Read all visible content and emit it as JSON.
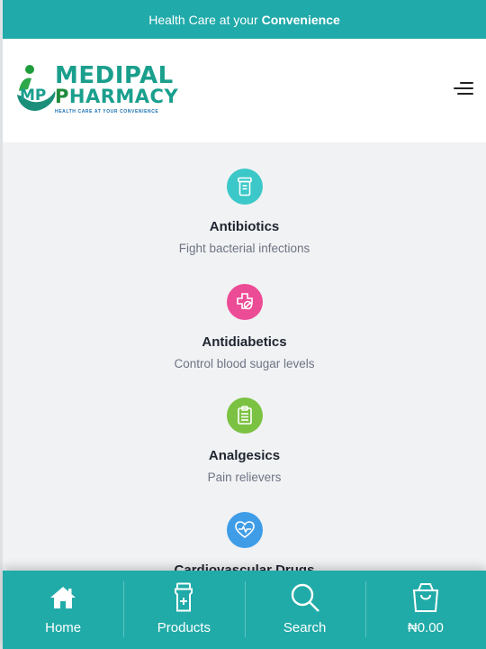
{
  "topbar": {
    "text": "Health Care at your",
    "bold": "Convenience"
  },
  "logo": {
    "mark": "MP",
    "line1": "MEDIPAL",
    "line2_first": "P",
    "line2_rest": "HARMACY",
    "tagline": "HEALTH CARE AT YOUR CONVENIENCE"
  },
  "header": {
    "menu_icon": "hamburger-menu-icon"
  },
  "categories": [
    {
      "title": "Antibiotics",
      "desc": "Fight bacterial infections",
      "icon": "pill-bottle-icon",
      "color": "#3cc8c8"
    },
    {
      "title": "Antidiabetics",
      "desc": "Control blood sugar levels",
      "icon": "medicine-box-icon",
      "color": "#ec4c96"
    },
    {
      "title": "Analgesics",
      "desc": "Pain relievers",
      "icon": "clipboard-list-icon",
      "color": "#7cc242"
    },
    {
      "title": "Cardiovascular Drugs",
      "desc": "",
      "icon": "heart-pulse-icon",
      "color": "#3f9de8"
    }
  ],
  "bottom_nav": [
    {
      "label": "Home",
      "icon": "home-icon"
    },
    {
      "label": "Products",
      "icon": "medicine-bottle-icon"
    },
    {
      "label": "Search",
      "icon": "search-icon"
    },
    {
      "label": "₦0.00",
      "icon": "shopping-bag-icon"
    }
  ],
  "colors": {
    "teal": "#20aaa9",
    "background": "#f1f2f4",
    "text_dark": "#1f2530",
    "text_muted": "#6e7484"
  }
}
